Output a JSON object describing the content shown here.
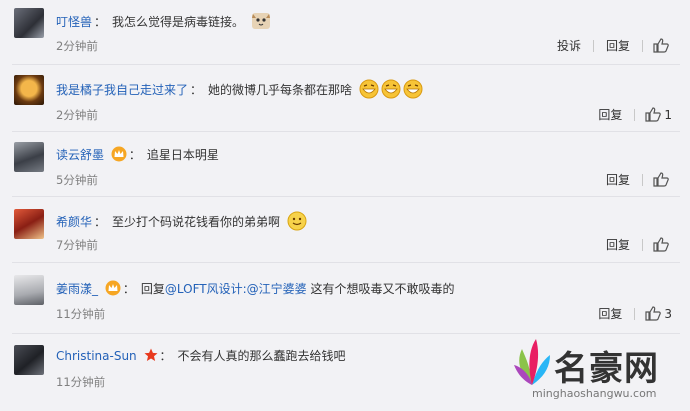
{
  "comments": [
    {
      "user": "叮怪兽",
      "sep": "：",
      "text": "我怎么觉得是病毒链接。",
      "time": "2分钟前",
      "report": "投诉",
      "reply": "回复",
      "likes": ""
    },
    {
      "user": "我是橘子我自己走过来了",
      "sep": "：",
      "text": "她的微博几乎每条都在那啥",
      "time": "2分钟前",
      "reply": "回复",
      "likes": "1"
    },
    {
      "user": "读云舒墨",
      "sep": "：",
      "text": "追星日本明星",
      "time": "5分钟前",
      "reply": "回复",
      "likes": ""
    },
    {
      "user": "希颜华",
      "sep": "：",
      "text": "至少打个码说花钱看你的弟弟啊",
      "time": "7分钟前",
      "reply": "回复",
      "likes": ""
    },
    {
      "user": "姜雨漾_",
      "sep": "：",
      "text_prefix": "回复",
      "mention": "@LOFT风设计:@江宁婆婆",
      "text": " 这有个想吸毒又不敢吸毒的",
      "time": "11分钟前",
      "reply": "回复",
      "likes": "3"
    },
    {
      "user": "Christina-Sun",
      "sep": "：",
      "text": "不会有人真的那么蠢跑去给钱吧",
      "time": "11分钟前"
    }
  ],
  "watermark": {
    "name": "名豪网",
    "url": "minghaoshangwu.com"
  },
  "colors": {
    "username": "#2462b8",
    "time": "#808080",
    "background": "#f2f2f5"
  }
}
